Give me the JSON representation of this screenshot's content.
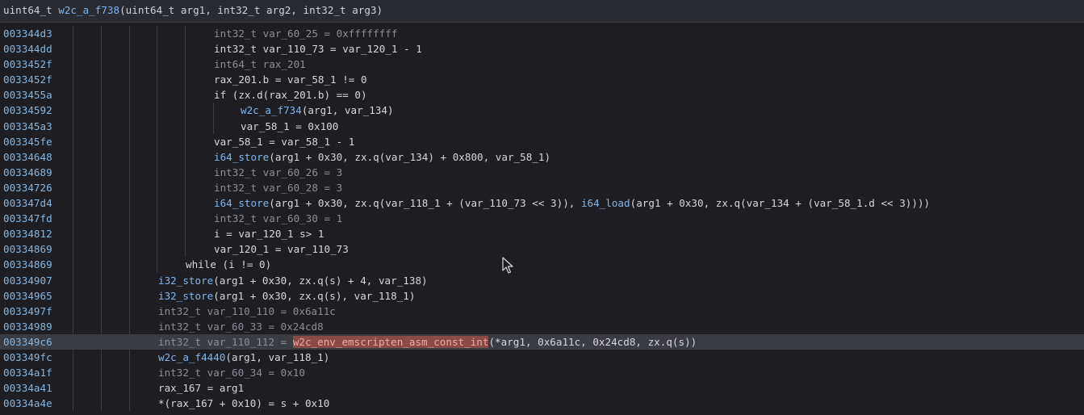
{
  "header": {
    "ret_type": "uint64_t ",
    "func_name": "w2c_a_f738",
    "params": "(uint64_t arg1, int32_t arg2, int32_t arg3)"
  },
  "rows": [
    {
      "addr": "003344d3",
      "indent": 5,
      "dim": true,
      "code": "int32_t var_60_25 = 0xffffffff"
    },
    {
      "addr": "003344dd",
      "indent": 5,
      "dim": false,
      "code": "int32_t var_110_73 = var_120_1 - 1"
    },
    {
      "addr": "0033452f",
      "indent": 5,
      "dim": true,
      "code": "int64_t rax_201"
    },
    {
      "addr": "0033452f",
      "indent": 5,
      "dim": false,
      "code": "rax_201.b = var_58_1 != 0"
    },
    {
      "addr": "0033455a",
      "indent": 5,
      "dim": false,
      "code": "if (zx.d(rax_201.b) == 0)"
    },
    {
      "addr": "00334592",
      "indent": 6,
      "dim": false,
      "code": "w2c_a_f734(arg1, var_134)",
      "fn": "w2c_a_f734"
    },
    {
      "addr": "003345a3",
      "indent": 6,
      "dim": false,
      "code": "var_58_1 = 0x100"
    },
    {
      "addr": "003345fe",
      "indent": 5,
      "dim": false,
      "code": "var_58_1 = var_58_1 - 1"
    },
    {
      "addr": "00334648",
      "indent": 5,
      "dim": false,
      "code": "i64_store(arg1 + 0x30, zx.q(var_134) + 0x800, var_58_1)",
      "fn": "i64_store"
    },
    {
      "addr": "00334689",
      "indent": 5,
      "dim": true,
      "code": "int32_t var_60_26 = 3"
    },
    {
      "addr": "00334726",
      "indent": 5,
      "dim": true,
      "code": "int32_t var_60_28 = 3"
    },
    {
      "addr": "003347d4",
      "indent": 5,
      "dim": false,
      "code": "i64_store(arg1 + 0x30, zx.q(var_118_1 + (var_110_73 << 3)), i64_load(arg1 + 0x30, zx.q(var_134 + (var_58_1.d << 3))))",
      "fn": "i64_store"
    },
    {
      "addr": "003347fd",
      "indent": 5,
      "dim": true,
      "code": "int32_t var_60_30 = 1"
    },
    {
      "addr": "00334812",
      "indent": 5,
      "dim": false,
      "code": "i = var_120_1 s> 1"
    },
    {
      "addr": "00334869",
      "indent": 5,
      "dim": false,
      "code": "var_120_1 = var_110_73"
    },
    {
      "addr": "00334869",
      "indent": 4,
      "dim": false,
      "code": "while (i != 0)"
    },
    {
      "addr": "00334907",
      "indent": 3,
      "dim": false,
      "code": "i32_store(arg1 + 0x30, zx.q(s) + 4, var_138)",
      "fn": "i32_store"
    },
    {
      "addr": "00334965",
      "indent": 3,
      "dim": false,
      "code": "i32_store(arg1 + 0x30, zx.q(s), var_118_1)",
      "fn": "i32_store"
    },
    {
      "addr": "0033497f",
      "indent": 3,
      "dim": true,
      "code": "int32_t var_110_110 = 0x6a11c"
    },
    {
      "addr": "00334989",
      "indent": 3,
      "dim": true,
      "code": "int32_t var_60_33 = 0x24cd8"
    },
    {
      "addr": "003349c6",
      "indent": 3,
      "dim": true,
      "code": "int32_t var_110_112 = ",
      "highlight": true,
      "hl_fn": "w2c_env_emscripten_asm_const_int",
      "rest": "(*arg1, 0x6a11c, 0x24cd8, zx.q(s))"
    },
    {
      "addr": "003349fc",
      "indent": 3,
      "dim": false,
      "code": "w2c_a_f4440(arg1, var_118_1)",
      "fn": "w2c_a_f4440"
    },
    {
      "addr": "00334a1f",
      "indent": 3,
      "dim": true,
      "code": "int32_t var_60_34 = 0x10"
    },
    {
      "addr": "00334a41",
      "indent": 3,
      "dim": false,
      "code": "rax_167 = arg1"
    },
    {
      "addr": "00334a4e",
      "indent": 3,
      "dim": false,
      "code": "*(rax_167 + 0x10) = s + 0x10"
    }
  ],
  "colors": {
    "background": "#1e1e22",
    "address": "#82b6e3",
    "function": "#7fb6f0",
    "highlight_line": "#3b3c42",
    "highlight_token": "#8a4a46"
  },
  "cursor_icon": "mouse-pointer-icon"
}
